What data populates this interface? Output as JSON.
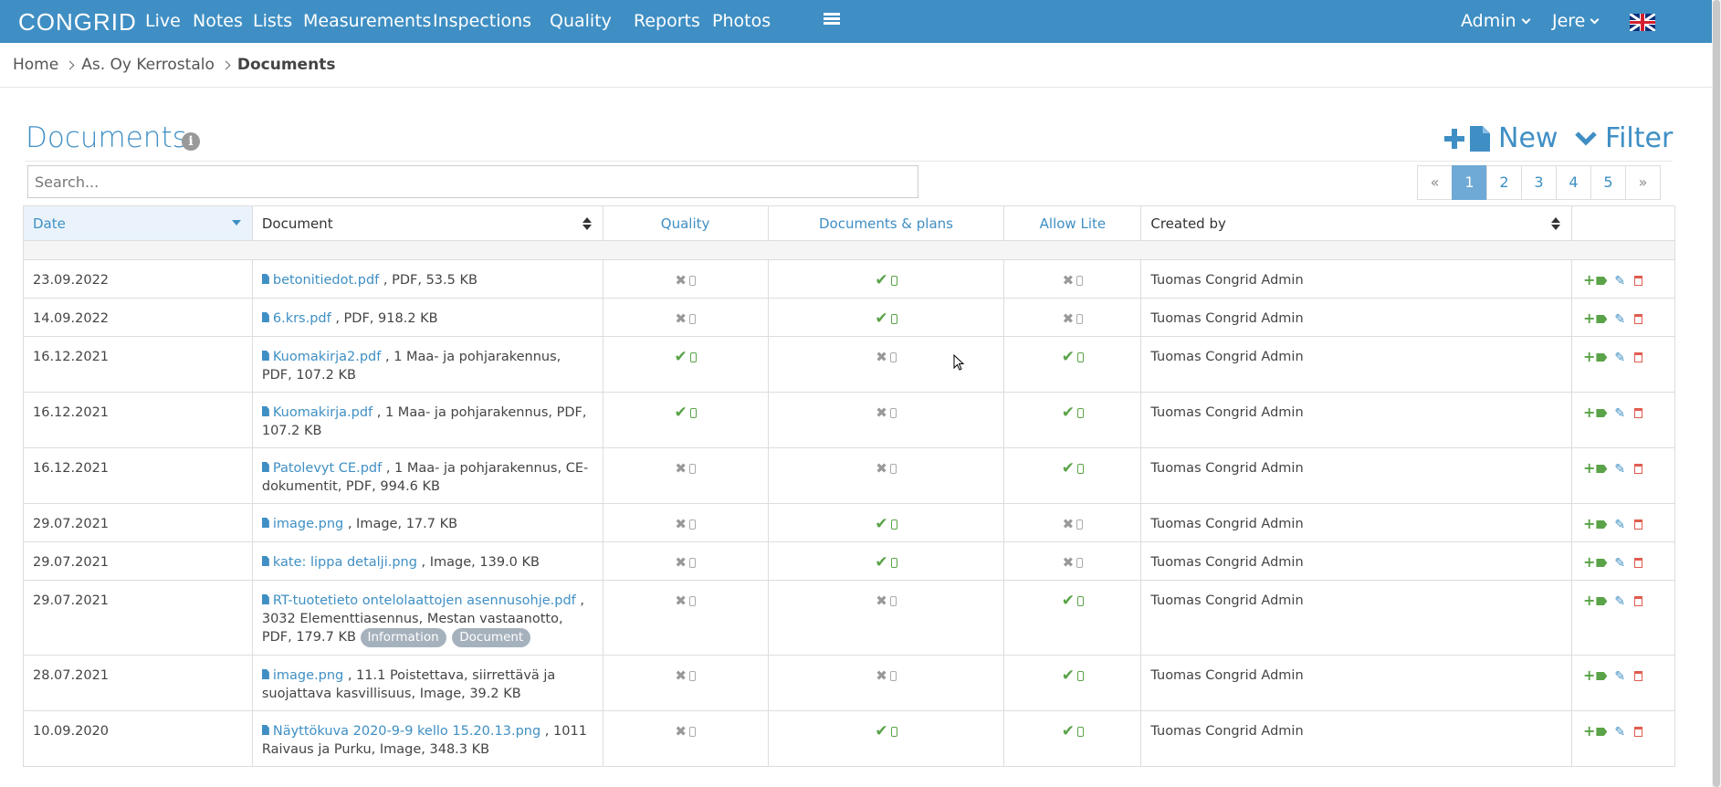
{
  "nav": {
    "logo": "CONGRID",
    "items": [
      "Live",
      "Notes",
      "Lists",
      "Measurements",
      "Inspections",
      "Quality",
      "Reports",
      "Photos"
    ],
    "menu_icon": "list-icon",
    "admin": "Admin",
    "user": "Jere",
    "flag": "uk-flag-icon"
  },
  "breadcrumb": {
    "home": "Home",
    "project": "As. Oy Kerrostalo",
    "current": "Documents"
  },
  "page": {
    "title": "Documents",
    "new_label": "New",
    "filter_label": "Filter",
    "search_placeholder": "Search..."
  },
  "pager": {
    "prev": "«",
    "pages": [
      "1",
      "2",
      "3",
      "4",
      "5"
    ],
    "next": "»",
    "active": "1"
  },
  "table": {
    "headers": {
      "date": "Date",
      "document": "Document",
      "quality": "Quality",
      "docs_plans": "Documents & plans",
      "allow_lite": "Allow Lite",
      "created_by": "Created by"
    },
    "rows": [
      {
        "date": "23.09.2022",
        "name": "betonitiedot.pdf",
        "meta": " , PDF, 53.5 KB",
        "tags": [],
        "quality": false,
        "docs": true,
        "lite": false,
        "creator": "Tuomas Congrid Admin"
      },
      {
        "date": "14.09.2022",
        "name": "6.krs.pdf",
        "meta": " , PDF, 918.2 KB",
        "tags": [],
        "quality": false,
        "docs": true,
        "lite": false,
        "creator": "Tuomas Congrid Admin"
      },
      {
        "date": "16.12.2021",
        "name": "Kuomakirja2.pdf",
        "meta": " , 1 Maa- ja pohjarakennus, PDF, 107.2 KB",
        "tags": [],
        "quality": true,
        "docs": false,
        "lite": true,
        "creator": "Tuomas Congrid Admin"
      },
      {
        "date": "16.12.2021",
        "name": "Kuomakirja.pdf",
        "meta": " , 1 Maa- ja pohjarakennus, PDF, 107.2 KB",
        "tags": [],
        "quality": true,
        "docs": false,
        "lite": true,
        "creator": "Tuomas Congrid Admin"
      },
      {
        "date": "16.12.2021",
        "name": "Patolevyt CE.pdf",
        "meta": " , 1 Maa- ja pohjarakennus, CE-dokumentit, PDF, 994.6 KB",
        "tags": [],
        "quality": false,
        "docs": false,
        "lite": true,
        "creator": "Tuomas Congrid Admin"
      },
      {
        "date": "29.07.2021",
        "name": "image.png",
        "meta": " , Image, 17.7 KB",
        "tags": [],
        "quality": false,
        "docs": true,
        "lite": false,
        "creator": "Tuomas Congrid Admin"
      },
      {
        "date": "29.07.2021",
        "name": "kate: lippa detalji.png",
        "meta": " , Image, 139.0 KB",
        "tags": [],
        "quality": false,
        "docs": true,
        "lite": false,
        "creator": "Tuomas Congrid Admin"
      },
      {
        "date": "29.07.2021",
        "name": "RT-tuotetieto ontelolaattojen asennusohje.pdf",
        "meta": " , 3032 Elementtiasennus, Mestan vastaanotto, PDF, 179.7 KB",
        "tags": [
          "Information",
          "Document"
        ],
        "quality": false,
        "docs": false,
        "lite": true,
        "creator": "Tuomas Congrid Admin"
      },
      {
        "date": "28.07.2021",
        "name": "image.png",
        "meta": " , 11.1 Poistettava, siirrettävä ja suojattava kasvillisuus, Image, 39.2 KB",
        "tags": [],
        "quality": false,
        "docs": false,
        "lite": true,
        "creator": "Tuomas Congrid Admin"
      },
      {
        "date": "10.09.2020",
        "name": "Näyttökuva 2020-9-9 kello 15.20.13.png",
        "meta": " , 1011 Raivaus ja Purku, Image, 348.3 KB",
        "tags": [],
        "quality": false,
        "docs": true,
        "lite": true,
        "creator": "Tuomas Congrid Admin"
      }
    ]
  },
  "colors": {
    "brand": "#3f8fc4",
    "ok": "#5aa348",
    "delete": "#e05c4f"
  }
}
